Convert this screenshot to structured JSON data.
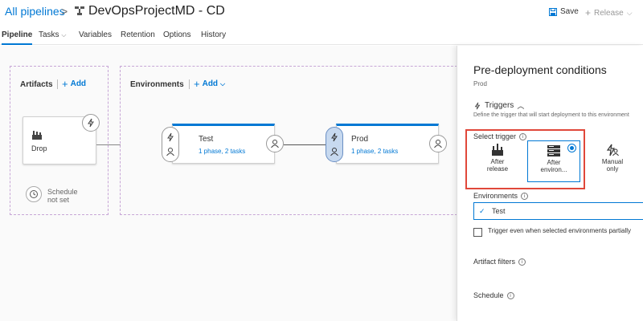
{
  "header": {
    "breadcrumb": "All pipelines",
    "separator": ">",
    "title": "DevOpsProjectMD - CD",
    "save_label": "Save",
    "release_label": "Release",
    "release_chevron": "⌵"
  },
  "tabs": [
    {
      "label": "Pipeline",
      "active": true
    },
    {
      "label": "Tasks",
      "chevron": "⌵"
    },
    {
      "label": "Variables"
    },
    {
      "label": "Retention"
    },
    {
      "label": "Options"
    },
    {
      "label": "History"
    }
  ],
  "artifacts": {
    "label": "Artifacts",
    "add_label": "Add",
    "card_name": "Drop",
    "schedule_text": "Schedule not set"
  },
  "environments": {
    "label": "Environments",
    "add_label": "Add",
    "items": [
      {
        "name": "Test",
        "subtitle": "1 phase, 2 tasks"
      },
      {
        "name": "Prod",
        "subtitle": "1 phase, 2 tasks"
      }
    ]
  },
  "panel": {
    "title": "Pre-deployment conditions",
    "subtitle": "Prod",
    "triggers_label": "Triggers",
    "triggers_description": "Define the trigger that will start deployment to this environment",
    "select_trigger_label": "Select trigger",
    "options": [
      {
        "label_line1": "After",
        "label_line2": "release",
        "selected": false
      },
      {
        "label_line1": "After",
        "label_line2": "environ...",
        "selected": true
      },
      {
        "label_line1": "Manual",
        "label_line2": "only",
        "selected": false
      }
    ],
    "environments_label": "Environments",
    "environments_value": "Test",
    "trigger_even_label": "Trigger even when selected environments partially",
    "artifact_filters_label": "Artifact filters",
    "schedule_label": "Schedule"
  },
  "colors": {
    "accent": "#0078d4",
    "highlight": "#e0483a",
    "dashed_border": "#c7a6d6"
  },
  "icons": [
    "pipeline-icon",
    "save-icon",
    "plus-icon",
    "chevron-down-icon",
    "trigger-icon",
    "user-icon",
    "clock-icon",
    "build-icon",
    "info-icon",
    "chevron-up-icon",
    "check-icon"
  ]
}
